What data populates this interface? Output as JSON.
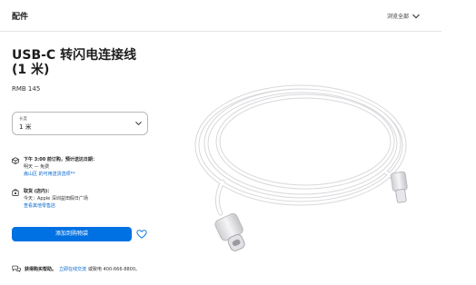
{
  "header": {
    "brand": "配件",
    "browse_all": "浏览全部"
  },
  "product": {
    "title_line1": "USB-C 转闪电连接线",
    "title_line2": "(1 米)",
    "price": "RMB 145"
  },
  "length_select": {
    "label": "长度",
    "value": "1 米"
  },
  "delivery": {
    "heading": "下午 3:00 前订购，预计送达日期：",
    "line": "明天 — 免费",
    "link": "嵩山区 的可用送货选项**"
  },
  "pickup": {
    "heading": "取货 (店内)：",
    "line": "今天：Apple 深圳益田假日广场",
    "link": "查看其他零售店"
  },
  "actions": {
    "add_to_bag": "添加到购物袋"
  },
  "help": {
    "label": "获得购买帮助。",
    "link": "立即在线交流",
    "phone_text": "或致电 400-666-8800。"
  },
  "colors": {
    "accent": "#0071e3",
    "link": "#0066cc"
  }
}
